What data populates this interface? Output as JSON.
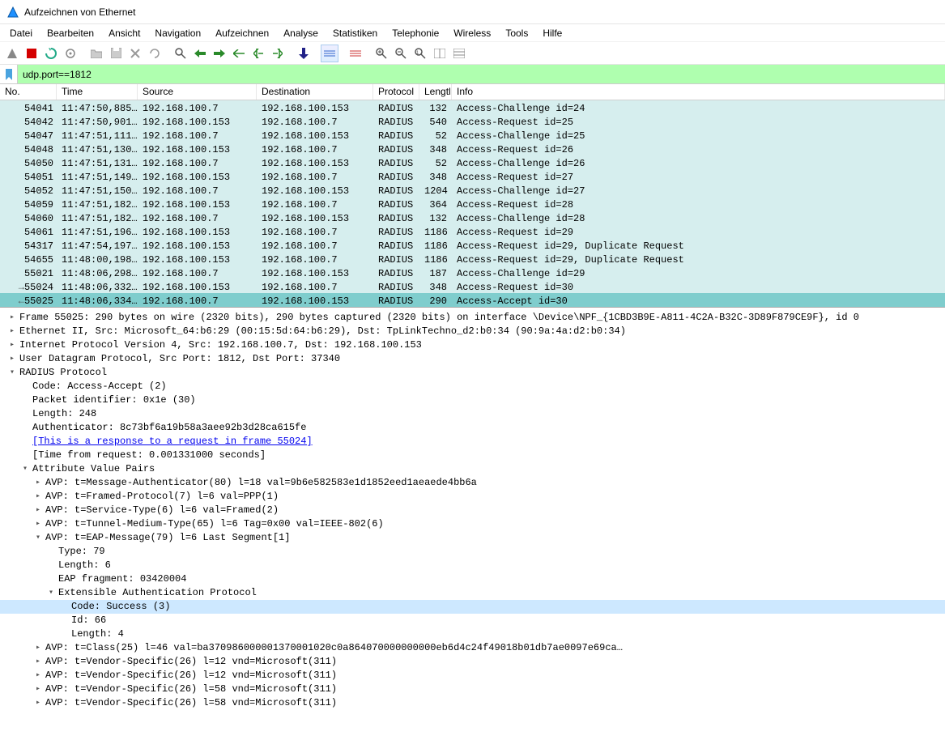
{
  "window": {
    "title": "Aufzeichnen von Ethernet"
  },
  "menu": {
    "file": "Datei",
    "edit": "Bearbeiten",
    "view": "Ansicht",
    "nav": "Navigation",
    "capture": "Aufzeichnen",
    "analyze": "Analyse",
    "stats": "Statistiken",
    "telephony": "Telephonie",
    "wireless": "Wireless",
    "tools": "Tools",
    "help": "Hilfe"
  },
  "filter": {
    "value": "udp.port==1812"
  },
  "columns": {
    "no": "No.",
    "time": "Time",
    "source": "Source",
    "destination": "Destination",
    "protocol": "Protocol",
    "length": "Lengtl",
    "info": "Info"
  },
  "packets": [
    {
      "no": "54041",
      "time": "11:47:50,885…",
      "src": "192.168.100.7",
      "dst": "192.168.100.153",
      "proto": "RADIUS",
      "len": "132",
      "info": "Access-Challenge id=24",
      "sel": false
    },
    {
      "no": "54042",
      "time": "11:47:50,901…",
      "src": "192.168.100.153",
      "dst": "192.168.100.7",
      "proto": "RADIUS",
      "len": "540",
      "info": "Access-Request id=25",
      "sel": false
    },
    {
      "no": "54047",
      "time": "11:47:51,111…",
      "src": "192.168.100.7",
      "dst": "192.168.100.153",
      "proto": "RADIUS",
      "len": "52",
      "info": "Access-Challenge id=25",
      "sel": false
    },
    {
      "no": "54048",
      "time": "11:47:51,130…",
      "src": "192.168.100.153",
      "dst": "192.168.100.7",
      "proto": "RADIUS",
      "len": "348",
      "info": "Access-Request id=26",
      "sel": false
    },
    {
      "no": "54050",
      "time": "11:47:51,131…",
      "src": "192.168.100.7",
      "dst": "192.168.100.153",
      "proto": "RADIUS",
      "len": "52",
      "info": "Access-Challenge id=26",
      "sel": false
    },
    {
      "no": "54051",
      "time": "11:47:51,149…",
      "src": "192.168.100.153",
      "dst": "192.168.100.7",
      "proto": "RADIUS",
      "len": "348",
      "info": "Access-Request id=27",
      "sel": false
    },
    {
      "no": "54052",
      "time": "11:47:51,150…",
      "src": "192.168.100.7",
      "dst": "192.168.100.153",
      "proto": "RADIUS",
      "len": "1204",
      "info": "Access-Challenge id=27",
      "sel": false
    },
    {
      "no": "54059",
      "time": "11:47:51,182…",
      "src": "192.168.100.153",
      "dst": "192.168.100.7",
      "proto": "RADIUS",
      "len": "364",
      "info": "Access-Request id=28",
      "sel": false
    },
    {
      "no": "54060",
      "time": "11:47:51,182…",
      "src": "192.168.100.7",
      "dst": "192.168.100.153",
      "proto": "RADIUS",
      "len": "132",
      "info": "Access-Challenge id=28",
      "sel": false
    },
    {
      "no": "54061",
      "time": "11:47:51,196…",
      "src": "192.168.100.153",
      "dst": "192.168.100.7",
      "proto": "RADIUS",
      "len": "1186",
      "info": "Access-Request id=29",
      "sel": false
    },
    {
      "no": "54317",
      "time": "11:47:54,197…",
      "src": "192.168.100.153",
      "dst": "192.168.100.7",
      "proto": "RADIUS",
      "len": "1186",
      "info": "Access-Request id=29, Duplicate Request",
      "sel": false
    },
    {
      "no": "54655",
      "time": "11:48:00,198…",
      "src": "192.168.100.153",
      "dst": "192.168.100.7",
      "proto": "RADIUS",
      "len": "1186",
      "info": "Access-Request id=29, Duplicate Request",
      "sel": false
    },
    {
      "no": "55021",
      "time": "11:48:06,298…",
      "src": "192.168.100.7",
      "dst": "192.168.100.153",
      "proto": "RADIUS",
      "len": "187",
      "info": "Access-Challenge id=29",
      "sel": false
    },
    {
      "no": "55024",
      "time": "11:48:06,332…",
      "src": "192.168.100.153",
      "dst": "192.168.100.7",
      "proto": "RADIUS",
      "len": "348",
      "info": "Access-Request id=30",
      "sel": false,
      "arrow": "→"
    },
    {
      "no": "55025",
      "time": "11:48:06,334…",
      "src": "192.168.100.7",
      "dst": "192.168.100.153",
      "proto": "RADIUS",
      "len": "290",
      "info": "Access-Accept id=30",
      "sel": true,
      "arrow": "←"
    }
  ],
  "tree": [
    {
      "indent": 0,
      "caret": ">",
      "text": "Frame 55025: 290 bytes on wire (2320 bits), 290 bytes captured (2320 bits) on interface \\Device\\NPF_{1CBD3B9E-A811-4C2A-B32C-3D89F879CE9F}, id 0"
    },
    {
      "indent": 0,
      "caret": ">",
      "text": "Ethernet II, Src: Microsoft_64:b6:29 (00:15:5d:64:b6:29), Dst: TpLinkTechno_d2:b0:34 (90:9a:4a:d2:b0:34)"
    },
    {
      "indent": 0,
      "caret": ">",
      "text": "Internet Protocol Version 4, Src: 192.168.100.7, Dst: 192.168.100.153"
    },
    {
      "indent": 0,
      "caret": ">",
      "text": "User Datagram Protocol, Src Port: 1812, Dst Port: 37340"
    },
    {
      "indent": 0,
      "caret": "v",
      "text": "RADIUS Protocol"
    },
    {
      "indent": 1,
      "caret": " ",
      "text": "Code: Access-Accept (2)"
    },
    {
      "indent": 1,
      "caret": " ",
      "text": "Packet identifier: 0x1e (30)"
    },
    {
      "indent": 1,
      "caret": " ",
      "text": "Length: 248"
    },
    {
      "indent": 1,
      "caret": " ",
      "text": "Authenticator: 8c73bf6a19b58a3aee92b3d28ca615fe"
    },
    {
      "indent": 1,
      "caret": " ",
      "link": true,
      "text": "[This is a response to a request in frame 55024]"
    },
    {
      "indent": 1,
      "caret": " ",
      "text": "[Time from request: 0.001331000 seconds]"
    },
    {
      "indent": 1,
      "caret": "v",
      "text": "Attribute Value Pairs"
    },
    {
      "indent": 2,
      "caret": ">",
      "text": "AVP: t=Message-Authenticator(80) l=18 val=9b6e582583e1d1852eed1aeaede4bb6a"
    },
    {
      "indent": 2,
      "caret": ">",
      "text": "AVP: t=Framed-Protocol(7) l=6 val=PPP(1)"
    },
    {
      "indent": 2,
      "caret": ">",
      "text": "AVP: t=Service-Type(6) l=6 val=Framed(2)"
    },
    {
      "indent": 2,
      "caret": ">",
      "text": "AVP: t=Tunnel-Medium-Type(65) l=6 Tag=0x00 val=IEEE-802(6)"
    },
    {
      "indent": 2,
      "caret": "v",
      "text": "AVP: t=EAP-Message(79) l=6 Last Segment[1]"
    },
    {
      "indent": 3,
      "caret": " ",
      "text": "Type: 79"
    },
    {
      "indent": 3,
      "caret": " ",
      "text": "Length: 6"
    },
    {
      "indent": 3,
      "caret": " ",
      "text": "EAP fragment: 03420004"
    },
    {
      "indent": 3,
      "caret": "v",
      "text": "Extensible Authentication Protocol"
    },
    {
      "indent": 4,
      "caret": " ",
      "hl": true,
      "text": "Code: Success (3)"
    },
    {
      "indent": 4,
      "caret": " ",
      "text": "Id: 66"
    },
    {
      "indent": 4,
      "caret": " ",
      "text": "Length: 4"
    },
    {
      "indent": 2,
      "caret": ">",
      "text": "AVP: t=Class(25) l=46 val=ba370986000001370001020c0a864070000000000eb6d4c24f49018b01db7ae0097e69ca…"
    },
    {
      "indent": 2,
      "caret": ">",
      "text": "AVP: t=Vendor-Specific(26) l=12 vnd=Microsoft(311)"
    },
    {
      "indent": 2,
      "caret": ">",
      "text": "AVP: t=Vendor-Specific(26) l=12 vnd=Microsoft(311)"
    },
    {
      "indent": 2,
      "caret": ">",
      "text": "AVP: t=Vendor-Specific(26) l=58 vnd=Microsoft(311)"
    },
    {
      "indent": 2,
      "caret": ">",
      "text": "AVP: t=Vendor-Specific(26) l=58 vnd=Microsoft(311)"
    }
  ]
}
